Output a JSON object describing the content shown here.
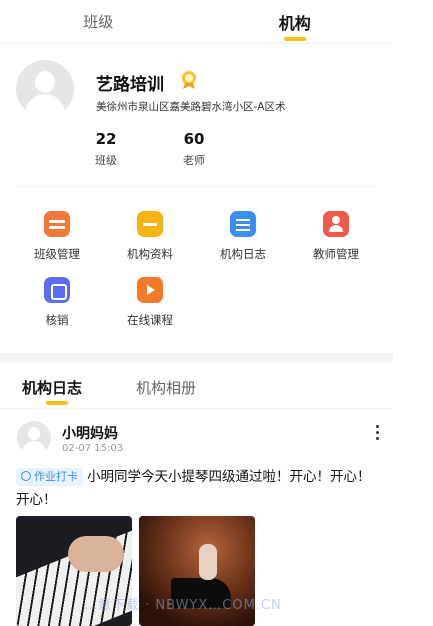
{
  "tabs": [
    {
      "label": "班级"
    },
    {
      "label": "机构"
    }
  ],
  "org": {
    "name": "艺路培训",
    "address": "美徐州市泉山区嘉美路碧水湾小区-A区术",
    "stats": [
      {
        "value": "22",
        "label": "班级"
      },
      {
        "value": "60",
        "label": "老师"
      }
    ]
  },
  "grid": [
    {
      "label": "班级管理",
      "icon": "class-management-icon"
    },
    {
      "label": "机构资料",
      "icon": "folder-icon"
    },
    {
      "label": "机构日志",
      "icon": "log-icon"
    },
    {
      "label": "教师管理",
      "icon": "teacher-icon"
    },
    {
      "label": "核销",
      "icon": "verify-icon"
    },
    {
      "label": "在线课程",
      "icon": "online-course-icon"
    }
  ],
  "section_tabs": [
    {
      "label": "机构日志"
    },
    {
      "label": "机构相册"
    }
  ],
  "post": {
    "author": "小明妈妈",
    "time": "02-07 15:03",
    "tag": "作业打卡",
    "text": "小明同学今天小提琴四级通过啦！开心！开心！开心！"
  },
  "watermark": "…意下载 · NBWYX…COM.CN",
  "colors": {
    "accent": "#f6c218",
    "tag": "#3a8ff0"
  }
}
